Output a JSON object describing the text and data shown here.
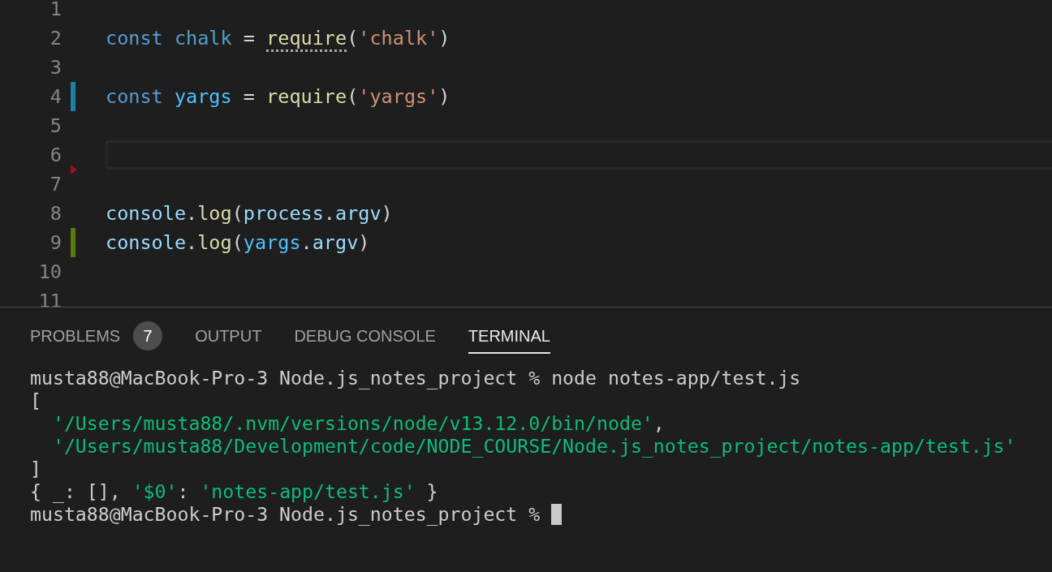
{
  "editor": {
    "lines": [
      {
        "number": "1",
        "kind": "plain",
        "current": false
      },
      {
        "number": "2",
        "kind": "plain",
        "current": false,
        "tokens": [
          {
            "kind": "keyword",
            "text": "const "
          },
          {
            "kind": "constant",
            "text": "chalk"
          },
          {
            "kind": "punct",
            "text": " = "
          },
          {
            "kind": "hinted",
            "text": "require"
          },
          {
            "kind": "punct",
            "text": "("
          },
          {
            "kind": "string",
            "text": "'chalk'"
          },
          {
            "kind": "punct",
            "text": ")"
          }
        ]
      },
      {
        "number": "3",
        "kind": "plain",
        "current": false
      },
      {
        "number": "4",
        "kind": "modified",
        "current": false,
        "tokens": [
          {
            "kind": "keyword",
            "text": "const "
          },
          {
            "kind": "variable",
            "text": "yargs"
          },
          {
            "kind": "punct",
            "text": " = "
          },
          {
            "kind": "func",
            "text": "require"
          },
          {
            "kind": "punct",
            "text": "("
          },
          {
            "kind": "string",
            "text": "'yargs'"
          },
          {
            "kind": "punct",
            "text": ")"
          }
        ]
      },
      {
        "number": "5",
        "kind": "plain",
        "current": false
      },
      {
        "number": "6",
        "kind": "plain",
        "current": true
      },
      {
        "number": "7",
        "kind": "deleted",
        "current": false
      },
      {
        "number": "8",
        "kind": "plain",
        "current": false,
        "tokens": [
          {
            "kind": "property",
            "text": "console"
          },
          {
            "kind": "punct",
            "text": "."
          },
          {
            "kind": "func",
            "text": "log"
          },
          {
            "kind": "punct",
            "text": "("
          },
          {
            "kind": "property",
            "text": "process"
          },
          {
            "kind": "punct",
            "text": "."
          },
          {
            "kind": "property",
            "text": "argv"
          },
          {
            "kind": "punct",
            "text": ")"
          }
        ]
      },
      {
        "number": "9",
        "kind": "added",
        "current": false,
        "tokens": [
          {
            "kind": "property",
            "text": "console"
          },
          {
            "kind": "punct",
            "text": "."
          },
          {
            "kind": "func",
            "text": "log"
          },
          {
            "kind": "punct",
            "text": "("
          },
          {
            "kind": "variable",
            "text": "yargs"
          },
          {
            "kind": "punct",
            "text": "."
          },
          {
            "kind": "property",
            "text": "argv"
          },
          {
            "kind": "punct",
            "text": ")"
          }
        ]
      },
      {
        "number": "10",
        "kind": "plain",
        "current": false
      },
      {
        "number": "11",
        "kind": "plain",
        "current": false
      }
    ]
  },
  "panel": {
    "tabs": [
      {
        "label": "PROBLEMS",
        "badge": "7",
        "selected": false
      },
      {
        "label": "OUTPUT",
        "selected": false
      },
      {
        "label": "DEBUG CONSOLE",
        "selected": false
      },
      {
        "label": "TERMINAL",
        "selected": true
      }
    ],
    "terminal": {
      "lines": [
        {
          "segments": [
            {
              "kind": "plain",
              "text": "musta88@MacBook-Pro-3 Node.js_notes_project % node notes-app/test.js"
            }
          ]
        },
        {
          "segments": [
            {
              "kind": "plain",
              "text": "["
            }
          ]
        },
        {
          "segments": [
            {
              "kind": "string",
              "text": "  '/Users/musta88/.nvm/versions/node/v13.12.0/bin/node'"
            },
            {
              "kind": "plain",
              "text": ","
            }
          ]
        },
        {
          "segments": [
            {
              "kind": "string",
              "text": "  '/Users/musta88/Development/code/NODE_COURSE/Node.js_notes_project/notes-app/test.js'"
            }
          ]
        },
        {
          "segments": [
            {
              "kind": "plain",
              "text": "]"
            }
          ]
        },
        {
          "segments": [
            {
              "kind": "plain",
              "text": "{ _: [], "
            },
            {
              "kind": "string",
              "text": "'$0'"
            },
            {
              "kind": "plain",
              "text": ": "
            },
            {
              "kind": "string",
              "text": "'notes-app/test.js'"
            },
            {
              "kind": "plain",
              "text": " }"
            }
          ]
        },
        {
          "segments": [
            {
              "kind": "plain",
              "text": "musta88@MacBook-Pro-3 Node.js_notes_project % "
            }
          ],
          "cursor": true
        }
      ]
    }
  }
}
